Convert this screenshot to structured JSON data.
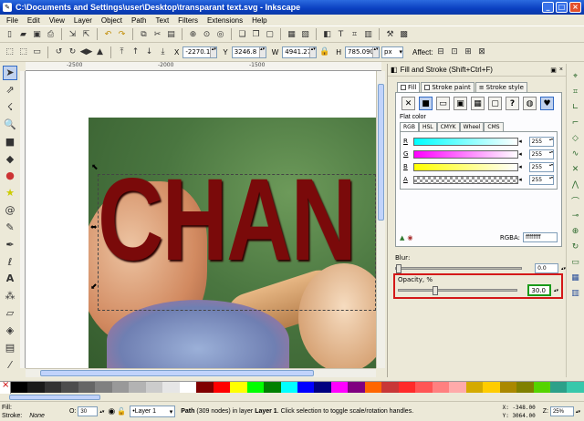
{
  "window": {
    "title": "C:\\Documents and Settings\\user\\Desktop\\transparant text.svg - Inkscape",
    "min_btn": "_",
    "max_btn": "□",
    "close_btn": "×"
  },
  "menu": [
    "File",
    "Edit",
    "View",
    "Layer",
    "Object",
    "Path",
    "Text",
    "Filters",
    "Extensions",
    "Help"
  ],
  "controls": {
    "x_label": "X",
    "x_value": "-2270.1",
    "y_label": "Y",
    "y_value": "3246.8",
    "w_label": "W",
    "w_value": "4941.27",
    "h_label": "H",
    "h_value": "785.090",
    "unit": "px",
    "affect_label": "Affect:"
  },
  "ruler": {
    "ticks": [
      "-2500",
      "-2000",
      "-1500"
    ]
  },
  "canvas": {
    "text": "CHAN"
  },
  "dialog": {
    "title": "Fill and Stroke (Shift+Ctrl+F)",
    "tabs": [
      "Fill",
      "Stroke paint",
      "Stroke style"
    ],
    "paint_unknown": "?",
    "flat_color_label": "Flat color",
    "color_modes": [
      "RGB",
      "HSL",
      "CMYK",
      "Wheel",
      "CMS"
    ],
    "channels": [
      {
        "label": "R",
        "value": "255"
      },
      {
        "label": "G",
        "value": "255"
      },
      {
        "label": "B",
        "value": "255"
      },
      {
        "label": "A",
        "value": "255"
      }
    ],
    "rgba_label": "RGBA:",
    "rgba_value": "ffffffff",
    "blur_label": "Blur:",
    "blur_value": "0.0",
    "opacity_label": "Opacity, %",
    "opacity_value": "30.0",
    "opacity": 30
  },
  "palette": [
    "#000000",
    "#1a1a1a",
    "#333333",
    "#4d4d4d",
    "#666666",
    "#808080",
    "#999999",
    "#b3b3b3",
    "#cccccc",
    "#e6e6e6",
    "#ffffff",
    "#800000",
    "#ff0000",
    "#ffff00",
    "#00ff00",
    "#008000",
    "#00ffff",
    "#0000ff",
    "#000080",
    "#ff00ff",
    "#800080",
    "#ff6600",
    "#c83737",
    "#ff2a2a",
    "#ff5555",
    "#ff8080",
    "#ffaaaa",
    "#d4aa00",
    "#ffcc00",
    "#aa8800",
    "#808000",
    "#55d400",
    "#2ca089",
    "#37c8ab"
  ],
  "status": {
    "fill_label": "Fill:",
    "stroke_label": "Stroke:",
    "stroke_value": "None",
    "o_label": "O:",
    "o_value": "30",
    "layer": "•Layer 1",
    "msg_type": "Path",
    "msg_rest": " (309 nodes) in layer ",
    "msg_layer": "Layer 1",
    "msg_tail": ". Click selection to toggle scale/rotation handles.",
    "x_coord": "X: -348.00",
    "y_coord": "Y: 3064.00",
    "zoom_label": "Z:",
    "zoom_value": "25%"
  }
}
